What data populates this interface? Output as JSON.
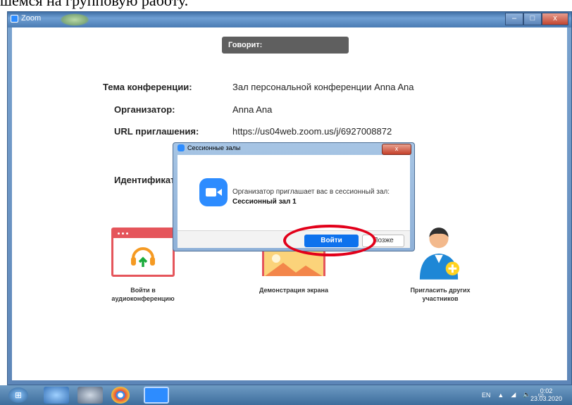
{
  "document": {
    "heading_fragment": "шемся на групповую работу."
  },
  "window": {
    "app_title": "Zoom",
    "buttons": {
      "minimize": "–",
      "maximize": "□",
      "close": "x"
    }
  },
  "meeting": {
    "speaker_label": "Говорит:",
    "topic_label": "Тема конференции:",
    "topic_value": "Зал персональной конференции Anna Ana",
    "host_label": "Организатор:",
    "host_value": "Anna Ana",
    "url_label": "URL приглашения:",
    "url_value": "https://us04web.zoom.us/j/6927008872",
    "id_label": "Идентификато"
  },
  "actions": {
    "audio_label_line1": "Войти в",
    "audio_label_line2": "аудиоконференцию",
    "share_label": "Демонстрация экрана",
    "invite_label_line1": "Пригласить других",
    "invite_label_line2": "участников"
  },
  "dialog": {
    "title": "Сессионные залы",
    "message": "Организатор приглашает вас в сессионный зал:",
    "room_name": "Сессионный зал 1",
    "join_label": "Войти",
    "later_label": "Позже",
    "close_label": "x"
  },
  "taskbar": {
    "lang": "EN",
    "time": "0:02",
    "date": "23.03.2020"
  },
  "colors": {
    "zoom_blue": "#2d8cff",
    "join_blue": "#0e72ed",
    "tile_red": "#e5555b",
    "highlight_red": "#e2001a"
  }
}
